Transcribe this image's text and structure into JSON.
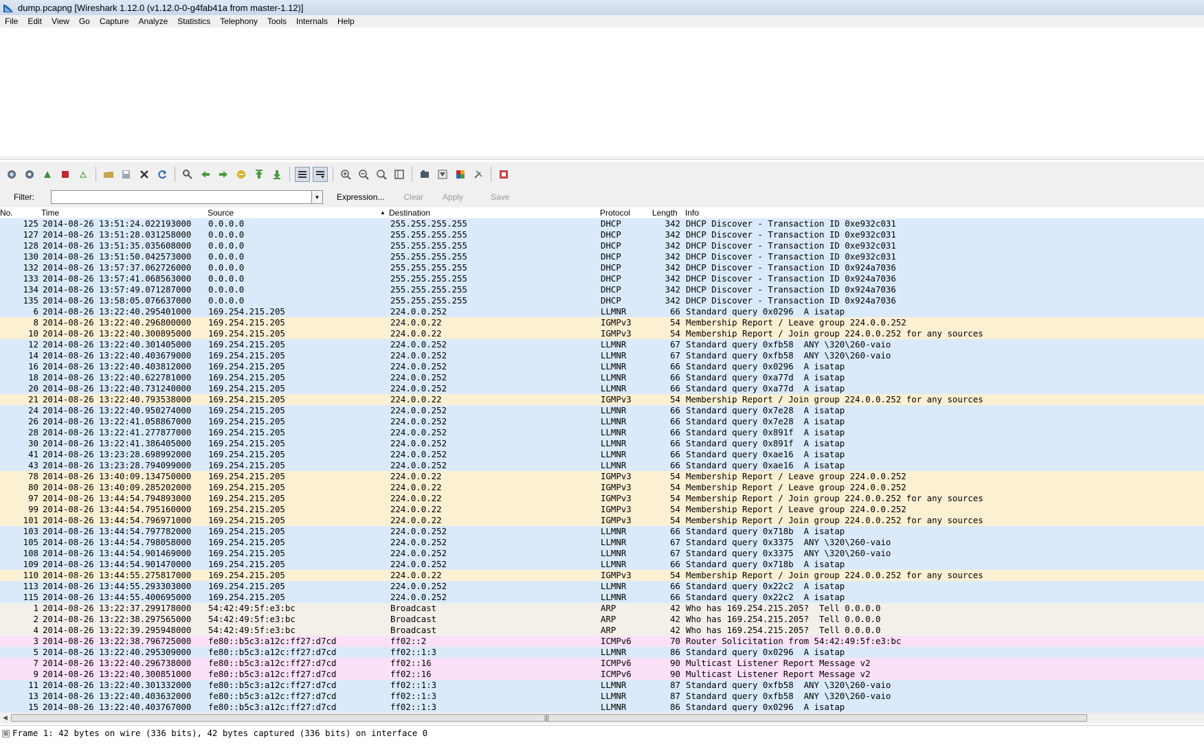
{
  "window": {
    "title": "dump.pcapng  [Wireshark 1.12.0  (v1.12.0-0-g4fab41a from master-1.12)]",
    "icon": "wireshark-fin-icon"
  },
  "menu": [
    "File",
    "Edit",
    "View",
    "Go",
    "Capture",
    "Analyze",
    "Statistics",
    "Telephony",
    "Tools",
    "Internals",
    "Help"
  ],
  "toolbar": {
    "groups": [
      [
        "interfaces-icon",
        "options-icon",
        "start-capture-icon",
        "stop-capture-icon",
        "restart-capture-icon"
      ],
      [
        "open-file-icon",
        "save-file-icon",
        "close-file-icon",
        "reload-icon"
      ],
      [
        "find-packet-icon",
        "go-back-icon",
        "go-forward-icon",
        "go-to-packet-icon",
        "first-packet-icon",
        "last-packet-icon"
      ],
      [
        "colorize-icon",
        "auto-scroll-icon"
      ],
      [
        "zoom-in-icon",
        "zoom-out-icon",
        "normal-size-icon",
        "resize-columns-icon"
      ],
      [
        "capture-filters-icon",
        "display-filters-icon",
        "coloring-rules-icon",
        "preferences-icon"
      ],
      [
        "help-icon"
      ]
    ]
  },
  "filter": {
    "label": "Filter:",
    "value": "",
    "expression": "Expression...",
    "clear": "Clear",
    "apply": "Apply",
    "save": "Save"
  },
  "columns": [
    "No.",
    "Time",
    "Source",
    "Destination",
    "Protocol",
    "Length",
    "Info"
  ],
  "rows": [
    {
      "no": "125",
      "time": "2014-08-26 13:51:24.022193000",
      "src": "0.0.0.0",
      "dst": "255.255.255.255",
      "proto": "DHCP",
      "len": "342",
      "info": "DHCP Discover - Transaction ID 0xe932c031",
      "bg": "#dbeafb"
    },
    {
      "no": "127",
      "time": "2014-08-26 13:51:28.031258000",
      "src": "0.0.0.0",
      "dst": "255.255.255.255",
      "proto": "DHCP",
      "len": "342",
      "info": "DHCP Discover - Transaction ID 0xe932c031",
      "bg": "#dbeafb"
    },
    {
      "no": "128",
      "time": "2014-08-26 13:51:35.035608000",
      "src": "0.0.0.0",
      "dst": "255.255.255.255",
      "proto": "DHCP",
      "len": "342",
      "info": "DHCP Discover - Transaction ID 0xe932c031",
      "bg": "#dbeafb"
    },
    {
      "no": "130",
      "time": "2014-08-26 13:51:50.042573000",
      "src": "0.0.0.0",
      "dst": "255.255.255.255",
      "proto": "DHCP",
      "len": "342",
      "info": "DHCP Discover - Transaction ID 0xe932c031",
      "bg": "#dbeafb"
    },
    {
      "no": "132",
      "time": "2014-08-26 13:57:37.062726000",
      "src": "0.0.0.0",
      "dst": "255.255.255.255",
      "proto": "DHCP",
      "len": "342",
      "info": "DHCP Discover - Transaction ID 0x924a7036",
      "bg": "#dbeafb"
    },
    {
      "no": "133",
      "time": "2014-08-26 13:57:41.068563000",
      "src": "0.0.0.0",
      "dst": "255.255.255.255",
      "proto": "DHCP",
      "len": "342",
      "info": "DHCP Discover - Transaction ID 0x924a7036",
      "bg": "#dbeafb"
    },
    {
      "no": "134",
      "time": "2014-08-26 13:57:49.071287000",
      "src": "0.0.0.0",
      "dst": "255.255.255.255",
      "proto": "DHCP",
      "len": "342",
      "info": "DHCP Discover - Transaction ID 0x924a7036",
      "bg": "#dbeafb"
    },
    {
      "no": "135",
      "time": "2014-08-26 13:58:05.076637000",
      "src": "0.0.0.0",
      "dst": "255.255.255.255",
      "proto": "DHCP",
      "len": "342",
      "info": "DHCP Discover - Transaction ID 0x924a7036",
      "bg": "#dbeafb"
    },
    {
      "no": "6",
      "time": "2014-08-26 13:22:40.295401000",
      "src": "169.254.215.205",
      "dst": "224.0.0.252",
      "proto": "LLMNR",
      "len": "66",
      "info": "Standard query 0x0296  A isatap",
      "bg": "#dbeafb"
    },
    {
      "no": "8",
      "time": "2014-08-26 13:22:40.296800000",
      "src": "169.254.215.205",
      "dst": "224.0.0.22",
      "proto": "IGMPv3",
      "len": "54",
      "info": "Membership Report / Leave group 224.0.0.252",
      "bg": "#fcf0d3"
    },
    {
      "no": "10",
      "time": "2014-08-26 13:22:40.300895000",
      "src": "169.254.215.205",
      "dst": "224.0.0.22",
      "proto": "IGMPv3",
      "len": "54",
      "info": "Membership Report / Join group 224.0.0.252 for any sources",
      "bg": "#fcf0d3"
    },
    {
      "no": "12",
      "time": "2014-08-26 13:22:40.301405000",
      "src": "169.254.215.205",
      "dst": "224.0.0.252",
      "proto": "LLMNR",
      "len": "67",
      "info": "Standard query 0xfb58  ANY \\320\\260-vaio",
      "bg": "#dbeafb"
    },
    {
      "no": "14",
      "time": "2014-08-26 13:22:40.403679000",
      "src": "169.254.215.205",
      "dst": "224.0.0.252",
      "proto": "LLMNR",
      "len": "67",
      "info": "Standard query 0xfb58  ANY \\320\\260-vaio",
      "bg": "#dbeafb"
    },
    {
      "no": "16",
      "time": "2014-08-26 13:22:40.403812000",
      "src": "169.254.215.205",
      "dst": "224.0.0.252",
      "proto": "LLMNR",
      "len": "66",
      "info": "Standard query 0x0296  A isatap",
      "bg": "#dbeafb"
    },
    {
      "no": "18",
      "time": "2014-08-26 13:22:40.622781000",
      "src": "169.254.215.205",
      "dst": "224.0.0.252",
      "proto": "LLMNR",
      "len": "66",
      "info": "Standard query 0xa77d  A isatap",
      "bg": "#dbeafb"
    },
    {
      "no": "20",
      "time": "2014-08-26 13:22:40.731240000",
      "src": "169.254.215.205",
      "dst": "224.0.0.252",
      "proto": "LLMNR",
      "len": "66",
      "info": "Standard query 0xa77d  A isatap",
      "bg": "#dbeafb"
    },
    {
      "no": "21",
      "time": "2014-08-26 13:22:40.793538000",
      "src": "169.254.215.205",
      "dst": "224.0.0.22",
      "proto": "IGMPv3",
      "len": "54",
      "info": "Membership Report / Join group 224.0.0.252 for any sources",
      "bg": "#fcf0d3"
    },
    {
      "no": "24",
      "time": "2014-08-26 13:22:40.950274000",
      "src": "169.254.215.205",
      "dst": "224.0.0.252",
      "proto": "LLMNR",
      "len": "66",
      "info": "Standard query 0x7e28  A isatap",
      "bg": "#dbeafb"
    },
    {
      "no": "26",
      "time": "2014-08-26 13:22:41.058867000",
      "src": "169.254.215.205",
      "dst": "224.0.0.252",
      "proto": "LLMNR",
      "len": "66",
      "info": "Standard query 0x7e28  A isatap",
      "bg": "#dbeafb"
    },
    {
      "no": "28",
      "time": "2014-08-26 13:22:41.277877000",
      "src": "169.254.215.205",
      "dst": "224.0.0.252",
      "proto": "LLMNR",
      "len": "66",
      "info": "Standard query 0x891f  A isatap",
      "bg": "#dbeafb"
    },
    {
      "no": "30",
      "time": "2014-08-26 13:22:41.386405000",
      "src": "169.254.215.205",
      "dst": "224.0.0.252",
      "proto": "LLMNR",
      "len": "66",
      "info": "Standard query 0x891f  A isatap",
      "bg": "#dbeafb"
    },
    {
      "no": "41",
      "time": "2014-08-26 13:23:28.698992000",
      "src": "169.254.215.205",
      "dst": "224.0.0.252",
      "proto": "LLMNR",
      "len": "66",
      "info": "Standard query 0xae16  A isatap",
      "bg": "#dbeafb"
    },
    {
      "no": "43",
      "time": "2014-08-26 13:23:28.794099000",
      "src": "169.254.215.205",
      "dst": "224.0.0.252",
      "proto": "LLMNR",
      "len": "66",
      "info": "Standard query 0xae16  A isatap",
      "bg": "#dbeafb"
    },
    {
      "no": "78",
      "time": "2014-08-26 13:40:09.134750000",
      "src": "169.254.215.205",
      "dst": "224.0.0.22",
      "proto": "IGMPv3",
      "len": "54",
      "info": "Membership Report / Leave group 224.0.0.252",
      "bg": "#fcf0d3"
    },
    {
      "no": "80",
      "time": "2014-08-26 13:40:09.285202000",
      "src": "169.254.215.205",
      "dst": "224.0.0.22",
      "proto": "IGMPv3",
      "len": "54",
      "info": "Membership Report / Leave group 224.0.0.252",
      "bg": "#fcf0d3"
    },
    {
      "no": "97",
      "time": "2014-08-26 13:44:54.794893000",
      "src": "169.254.215.205",
      "dst": "224.0.0.22",
      "proto": "IGMPv3",
      "len": "54",
      "info": "Membership Report / Join group 224.0.0.252 for any sources",
      "bg": "#fcf0d3"
    },
    {
      "no": "99",
      "time": "2014-08-26 13:44:54.795160000",
      "src": "169.254.215.205",
      "dst": "224.0.0.22",
      "proto": "IGMPv3",
      "len": "54",
      "info": "Membership Report / Leave group 224.0.0.252",
      "bg": "#fcf0d3"
    },
    {
      "no": "101",
      "time": "2014-08-26 13:44:54.796971000",
      "src": "169.254.215.205",
      "dst": "224.0.0.22",
      "proto": "IGMPv3",
      "len": "54",
      "info": "Membership Report / Join group 224.0.0.252 for any sources",
      "bg": "#fcf0d3"
    },
    {
      "no": "103",
      "time": "2014-08-26 13:44:54.797782000",
      "src": "169.254.215.205",
      "dst": "224.0.0.252",
      "proto": "LLMNR",
      "len": "66",
      "info": "Standard query 0x718b  A isatap",
      "bg": "#dbeafb"
    },
    {
      "no": "105",
      "time": "2014-08-26 13:44:54.798058000",
      "src": "169.254.215.205",
      "dst": "224.0.0.252",
      "proto": "LLMNR",
      "len": "67",
      "info": "Standard query 0x3375  ANY \\320\\260-vaio",
      "bg": "#dbeafb"
    },
    {
      "no": "108",
      "time": "2014-08-26 13:44:54.901469000",
      "src": "169.254.215.205",
      "dst": "224.0.0.252",
      "proto": "LLMNR",
      "len": "67",
      "info": "Standard query 0x3375  ANY \\320\\260-vaio",
      "bg": "#dbeafb"
    },
    {
      "no": "109",
      "time": "2014-08-26 13:44:54.901470000",
      "src": "169.254.215.205",
      "dst": "224.0.0.252",
      "proto": "LLMNR",
      "len": "66",
      "info": "Standard query 0x718b  A isatap",
      "bg": "#dbeafb"
    },
    {
      "no": "110",
      "time": "2014-08-26 13:44:55.275817000",
      "src": "169.254.215.205",
      "dst": "224.0.0.22",
      "proto": "IGMPv3",
      "len": "54",
      "info": "Membership Report / Join group 224.0.0.252 for any sources",
      "bg": "#fcf0d3"
    },
    {
      "no": "113",
      "time": "2014-08-26 13:44:55.293303000",
      "src": "169.254.215.205",
      "dst": "224.0.0.252",
      "proto": "LLMNR",
      "len": "66",
      "info": "Standard query 0x22c2  A isatap",
      "bg": "#dbeafb"
    },
    {
      "no": "115",
      "time": "2014-08-26 13:44:55.400695000",
      "src": "169.254.215.205",
      "dst": "224.0.0.252",
      "proto": "LLMNR",
      "len": "66",
      "info": "Standard query 0x22c2  A isatap",
      "bg": "#dbeafb"
    },
    {
      "no": "1",
      "time": "2014-08-26 13:22:37.299178000",
      "src": "54:42:49:5f:e3:bc",
      "dst": "Broadcast",
      "proto": "ARP",
      "len": "42",
      "info": "Who has 169.254.215.205?  Tell 0.0.0.0",
      "bg": "#f3f0ea"
    },
    {
      "no": "2",
      "time": "2014-08-26 13:22:38.297565000",
      "src": "54:42:49:5f:e3:bc",
      "dst": "Broadcast",
      "proto": "ARP",
      "len": "42",
      "info": "Who has 169.254.215.205?  Tell 0.0.0.0",
      "bg": "#f3f0ea"
    },
    {
      "no": "4",
      "time": "2014-08-26 13:22:39.295948000",
      "src": "54:42:49:5f:e3:bc",
      "dst": "Broadcast",
      "proto": "ARP",
      "len": "42",
      "info": "Who has 169.254.215.205?  Tell 0.0.0.0",
      "bg": "#f3f0ea"
    },
    {
      "no": "3",
      "time": "2014-08-26 13:22:38.796725000",
      "src": "fe80::b5c3:a12c:ff27:d7cd",
      "dst": "ff02::2",
      "proto": "ICMPv6",
      "len": "70",
      "info": "Router Solicitation from 54:42:49:5f:e3:bc",
      "bg": "#fbe0f7"
    },
    {
      "no": "5",
      "time": "2014-08-26 13:22:40.295309000",
      "src": "fe80::b5c3:a12c:ff27:d7cd",
      "dst": "ff02::1:3",
      "proto": "LLMNR",
      "len": "86",
      "info": "Standard query 0x0296  A isatap",
      "bg": "#dbeafb"
    },
    {
      "no": "7",
      "time": "2014-08-26 13:22:40.296738000",
      "src": "fe80::b5c3:a12c:ff27:d7cd",
      "dst": "ff02::16",
      "proto": "ICMPv6",
      "len": "90",
      "info": "Multicast Listener Report Message v2",
      "bg": "#fbe0f7"
    },
    {
      "no": "9",
      "time": "2014-08-26 13:22:40.300851000",
      "src": "fe80::b5c3:a12c:ff27:d7cd",
      "dst": "ff02::16",
      "proto": "ICMPv6",
      "len": "90",
      "info": "Multicast Listener Report Message v2",
      "bg": "#fbe0f7"
    },
    {
      "no": "11",
      "time": "2014-08-26 13:22:40.301332000",
      "src": "fe80::b5c3:a12c:ff27:d7cd",
      "dst": "ff02::1:3",
      "proto": "LLMNR",
      "len": "87",
      "info": "Standard query 0xfb58  ANY \\320\\260-vaio",
      "bg": "#dbeafb"
    },
    {
      "no": "13",
      "time": "2014-08-26 13:22:40.403632000",
      "src": "fe80::b5c3:a12c:ff27:d7cd",
      "dst": "ff02::1:3",
      "proto": "LLMNR",
      "len": "87",
      "info": "Standard query 0xfb58  ANY \\320\\260-vaio",
      "bg": "#dbeafb"
    },
    {
      "no": "15",
      "time": "2014-08-26 13:22:40.403767000",
      "src": "fe80::b5c3:a12c:ff27:d7cd",
      "dst": "ff02::1:3",
      "proto": "LLMNR",
      "len": "86",
      "info": "Standard query 0x0296  A isatap",
      "bg": "#dbeafb"
    }
  ],
  "detail": {
    "expander": "⊞",
    "line": "Frame 1: 42 bytes on wire (336 bits), 42 bytes captured (336 bits) on interface 0"
  }
}
